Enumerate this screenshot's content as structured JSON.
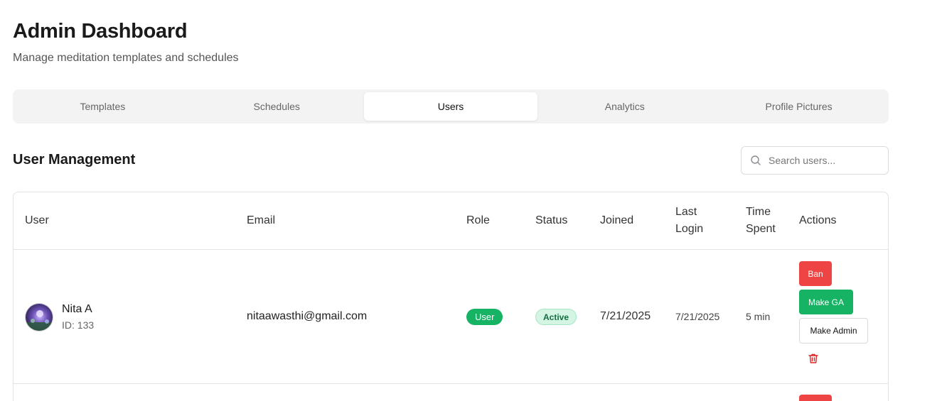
{
  "header": {
    "title": "Admin Dashboard",
    "subtitle": "Manage meditation templates and schedules"
  },
  "tabs": [
    {
      "label": "Templates",
      "active": false
    },
    {
      "label": "Schedules",
      "active": false
    },
    {
      "label": "Users",
      "active": true
    },
    {
      "label": "Analytics",
      "active": false
    },
    {
      "label": "Profile Pictures",
      "active": false
    }
  ],
  "section": {
    "title": "User Management"
  },
  "search": {
    "placeholder": "Search users...",
    "value": "",
    "icon": "search-icon"
  },
  "table": {
    "columns": {
      "user": "User",
      "email": "Email",
      "role": "Role",
      "status": "Status",
      "joined": "Joined",
      "last_login_1": "Last",
      "last_login_2": "Login",
      "time_spent_1": "Time",
      "time_spent_2": "Spent",
      "actions": "Actions"
    },
    "rows": [
      {
        "name": "Nita A",
        "id": "ID: 133",
        "email": "nitaawasthi@gmail.com",
        "role": "User",
        "status": "Active",
        "joined": "7/21/2025",
        "last_login": "7/21/2025",
        "time_spent": "5 min",
        "actions": {
          "ban": "Ban",
          "make_ga": "Make GA",
          "make_admin": "Make Admin",
          "delete_icon": "trash-icon"
        }
      }
    ]
  },
  "colors": {
    "danger": "#ef4444",
    "success": "#16b364",
    "status_bg": "#d4f5e3",
    "status_text": "#146c43",
    "tabs_bg": "#f3f3f4"
  }
}
